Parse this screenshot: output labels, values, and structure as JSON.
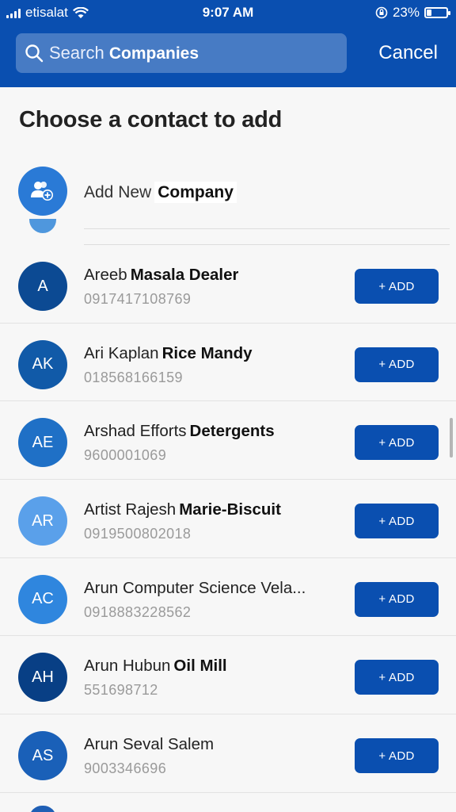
{
  "status": {
    "carrier": "etisalat",
    "time": "9:07 AM",
    "battery": "23%",
    "battery_level": 0.23
  },
  "search": {
    "placeholder_prefix": "Search",
    "placeholder_bold": "Companies",
    "cancel_label": "Cancel"
  },
  "page": {
    "title": "Choose a contact to add"
  },
  "add_new": {
    "label": "Add New",
    "label_bold": "Company",
    "icon": "add-user-icon"
  },
  "contacts": [
    {
      "initials": "A",
      "name": "Areeb",
      "name_bold": "Masala Dealer",
      "phone": "0917417108769",
      "color": "#0c4a93",
      "button": "+ ADD"
    },
    {
      "initials": "AK",
      "name": "Ari Kaplan",
      "name_bold": "Rice Mandy",
      "phone": "018568166159",
      "color": "#115aa8",
      "button": "+ ADD"
    },
    {
      "initials": "AE",
      "name": "Arshad Efforts",
      "name_bold": "Detergents",
      "phone": "9600001069",
      "color": "#1f70c6",
      "button": "+ ADD"
    },
    {
      "initials": "AR",
      "name": "Artist Rajesh",
      "name_bold": "Marie-Biscuit",
      "phone": "0919500802018",
      "color": "#5aa0ea",
      "button": "+ ADD"
    },
    {
      "initials": "AC",
      "name": "Arun Computer Science Vela...",
      "name_bold": "",
      "phone": "0918883228562",
      "color": "#2f86de",
      "button": "+ ADD"
    },
    {
      "initials": "AH",
      "name": "Arun Hubun",
      "name_bold": "Oil Mill",
      "phone": "551698712",
      "color": "#083f85",
      "button": "+ ADD"
    },
    {
      "initials": "AS",
      "name": "Arun Seval Salem",
      "name_bold": "",
      "phone": "9003346696",
      "color": "#1a60b8",
      "button": "+ ADD"
    }
  ]
}
